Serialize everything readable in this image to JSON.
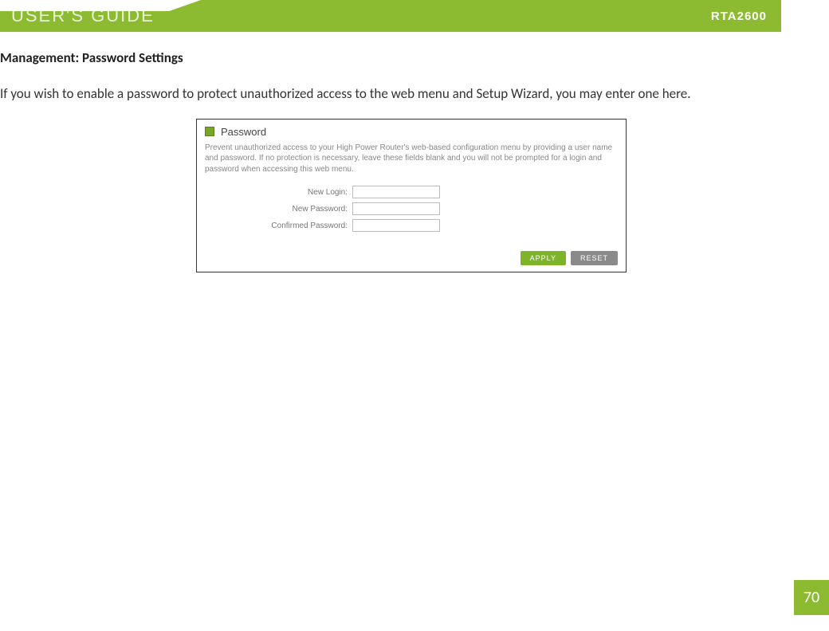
{
  "header": {
    "title": "USER'S GUIDE",
    "model": "RTA2600"
  },
  "section": {
    "title": "Management: Password Settings",
    "description": "If you wish to enable a password to protect unauthorized access to the web menu and Setup Wizard, you may enter one here."
  },
  "panel": {
    "heading": "Password",
    "description": "Prevent unauthorized access to your High Power Router's web-based configuration menu by providing a user name and password. If no protection is necessary, leave these fields blank and you will not be prompted for a login and password when accessing this web menu.",
    "fields": {
      "login_label": "New Login:",
      "password_label": "New Password:",
      "confirm_label": "Confirmed Password:",
      "login_value": "",
      "password_value": "",
      "confirm_value": ""
    },
    "buttons": {
      "apply": "APPLY",
      "reset": "RESET"
    }
  },
  "page_number": "70"
}
